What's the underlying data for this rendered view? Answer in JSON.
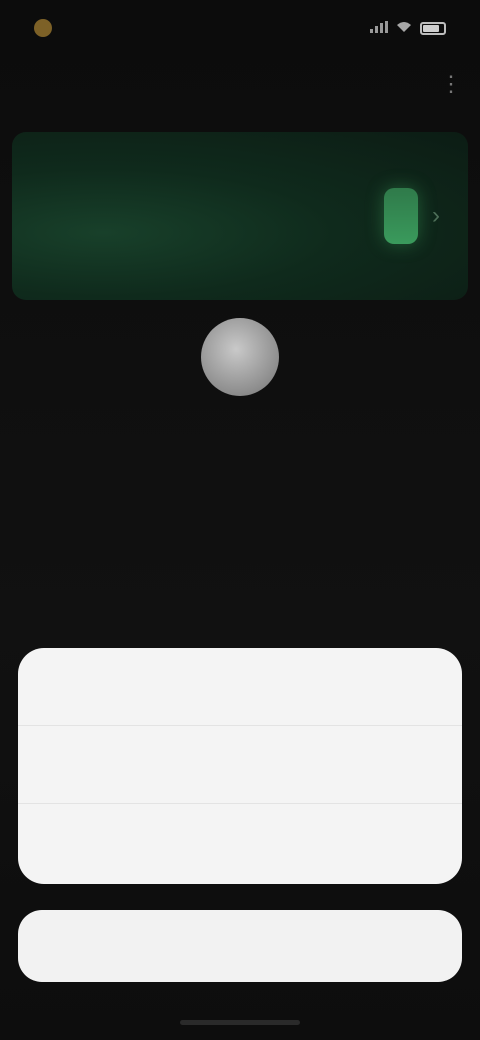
{
  "status_bar": {
    "time": "",
    "icons": [
      "app-indicator-icon",
      "signal-icon",
      "wifi-icon",
      "battery-icon"
    ],
    "signal_text": ""
  },
  "header": {
    "title": "",
    "more_icon": "more-icon"
  },
  "banner": {
    "text": "",
    "accent_color": "#3a9a5c"
  },
  "empty_state": {
    "title": "",
    "subtitle": ""
  },
  "action_sheet": {
    "options": [
      {
        "label": ""
      },
      {
        "label": ""
      },
      {
        "label": ""
      }
    ],
    "cancel_label": ""
  }
}
